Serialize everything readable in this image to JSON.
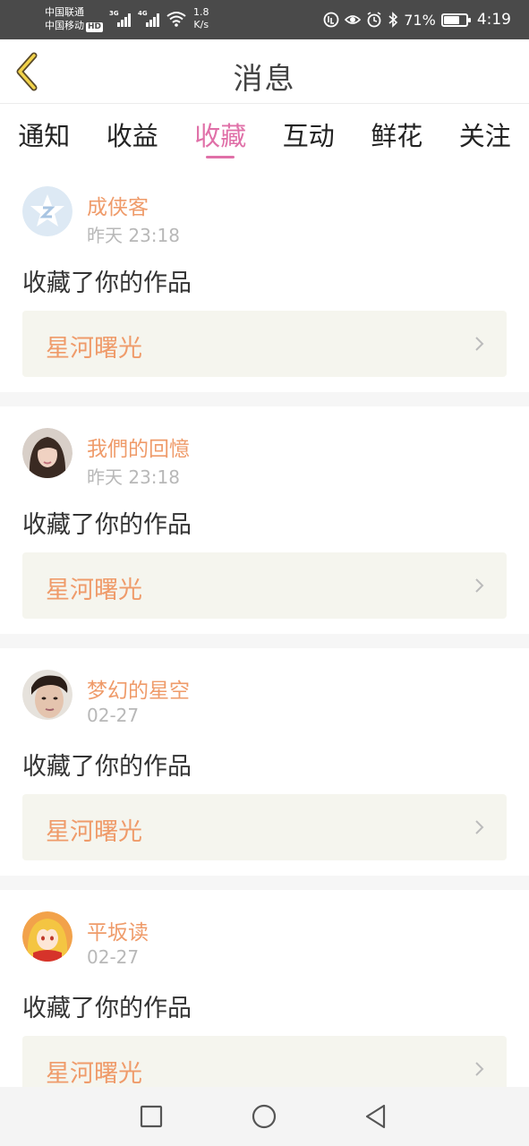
{
  "status_bar": {
    "carrier_1": "中国联通",
    "carrier_2": "中国移动",
    "hd_badge": "HD",
    "sig1_tag": "3G",
    "sig2_tag": "4G",
    "net_speed_value": "1.8",
    "net_speed_unit": "K/s",
    "battery_percent": "71%",
    "battery_level": 0.71,
    "clock": "4:19"
  },
  "header": {
    "title": "消息"
  },
  "tabs": [
    {
      "label": "通知"
    },
    {
      "label": "收益"
    },
    {
      "label": "收藏",
      "active": true
    },
    {
      "label": "互动"
    },
    {
      "label": "鲜花"
    },
    {
      "label": "关注"
    }
  ],
  "messages": [
    {
      "user": "成侠客",
      "time": "昨天 23:18",
      "action": "收藏了你的作品",
      "work": "星河曙光",
      "avatar": "qq-default-avatar"
    },
    {
      "user": "我們的回憶",
      "time": "昨天 23:18",
      "action": "收藏了你的作品",
      "work": "星河曙光",
      "avatar": "woman-photo-avatar"
    },
    {
      "user": "梦幻的星空",
      "time": "02-27",
      "action": "收藏了你的作品",
      "work": "星河曙光",
      "avatar": "man-photo-avatar"
    },
    {
      "user": "平坂读",
      "time": "02-27",
      "action": "收藏了你的作品",
      "work": "星河曙光",
      "avatar": "anime-girl-avatar"
    }
  ],
  "colors": {
    "accent_pink": "#e070a8",
    "username_orange": "#ef9b6a",
    "work_bg": "#f5f5ee"
  }
}
